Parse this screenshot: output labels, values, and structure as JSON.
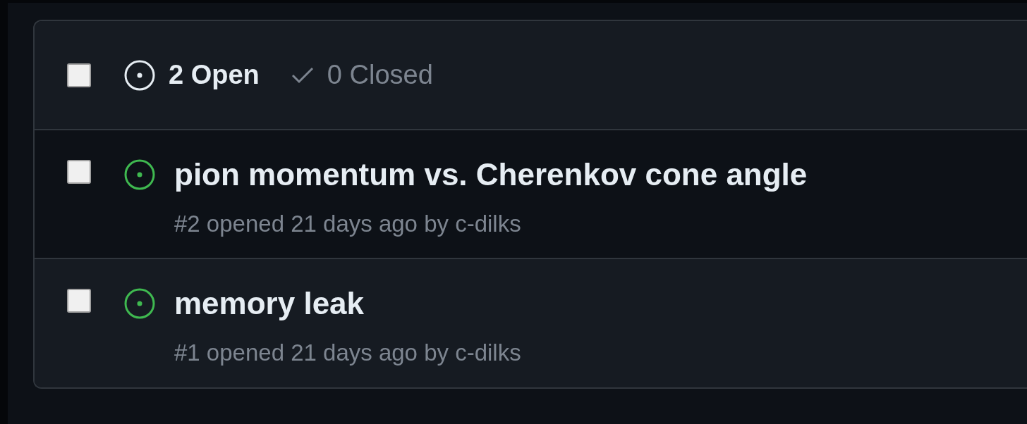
{
  "header": {
    "checked": false,
    "tabs": [
      {
        "kind": "open",
        "label": "2 Open",
        "selected": true
      },
      {
        "kind": "closed",
        "label": "0 Closed",
        "selected": false
      }
    ]
  },
  "issues": [
    {
      "title": "pion momentum vs. Cherenkov cone angle",
      "meta": "#2 opened 21 days ago by c-dilks",
      "kind": "open",
      "checked": false
    },
    {
      "title": "memory leak",
      "meta": "#1 opened 21 days ago by c-dilks",
      "kind": "open",
      "checked": false
    }
  ]
}
